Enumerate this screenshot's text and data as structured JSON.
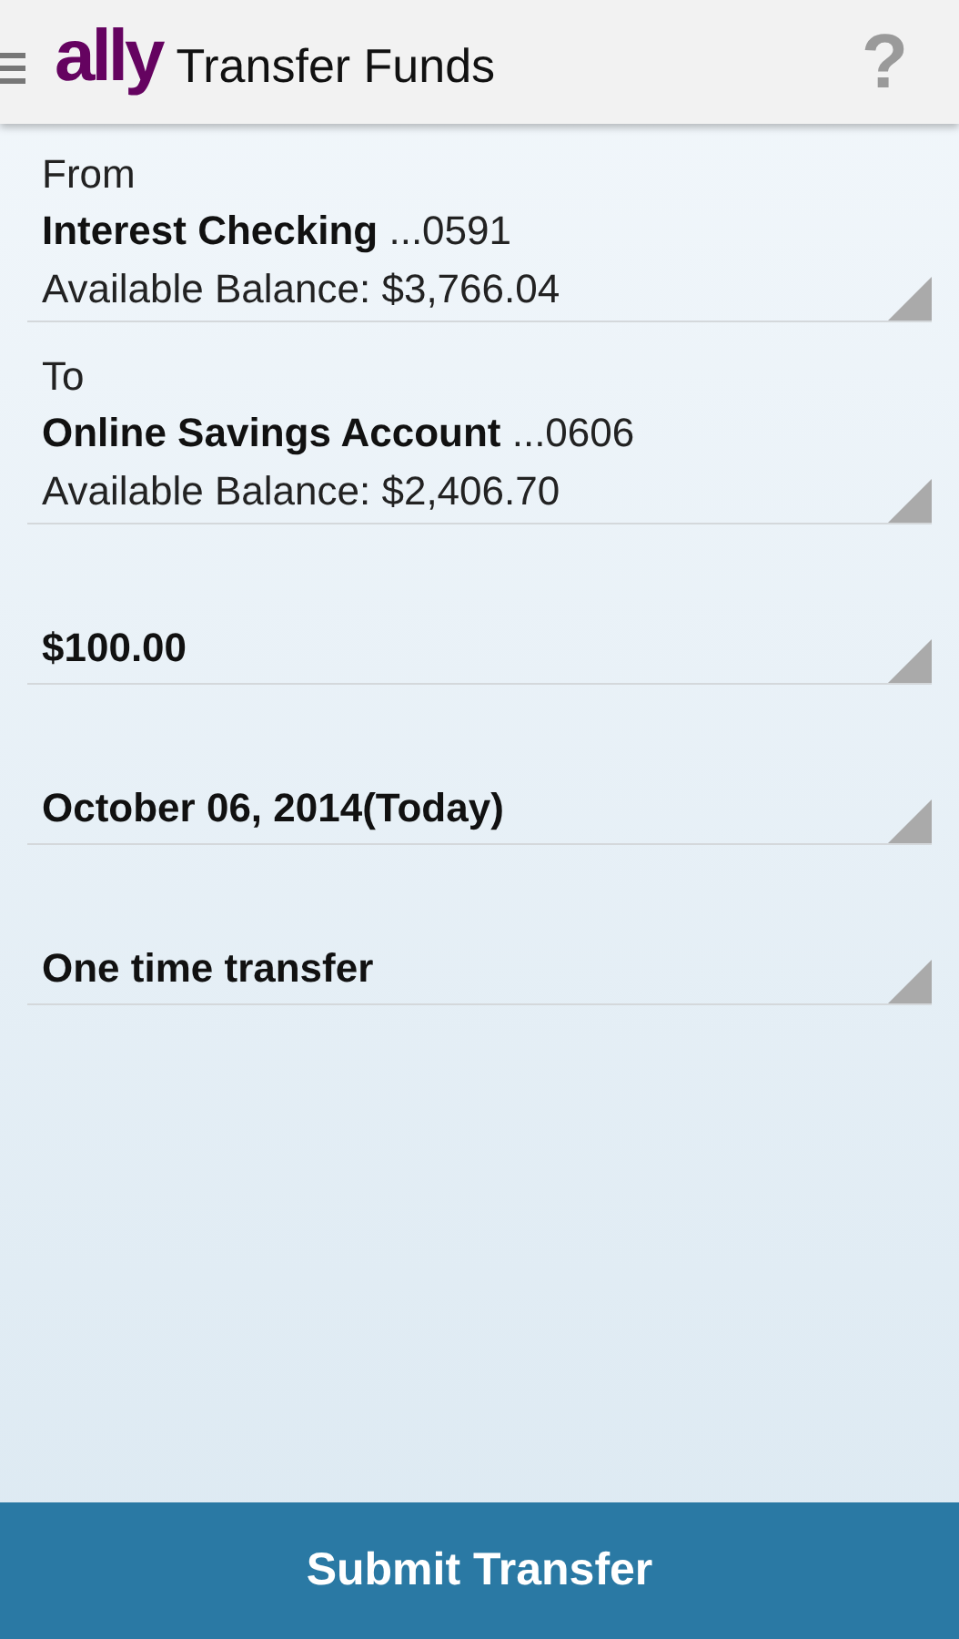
{
  "header": {
    "logo": "ally",
    "title": "Transfer Funds",
    "help": "?"
  },
  "fields": [
    {
      "kind": "account",
      "label": "From",
      "account": "**Interest Checking** ...0591",
      "balance": "Available Balance: $3,766.04"
    },
    {
      "kind": "account",
      "label": "To",
      "account": "**Online Savings Account** ...0606",
      "balance": "Available Balance: $2,406.70"
    },
    {
      "kind": "simple",
      "value": "$100.00"
    },
    {
      "kind": "simple",
      "value": "October 06, 2014(Today)"
    },
    {
      "kind": "simple",
      "value": "One time transfer"
    }
  ],
  "submit": "Submit Transfer"
}
